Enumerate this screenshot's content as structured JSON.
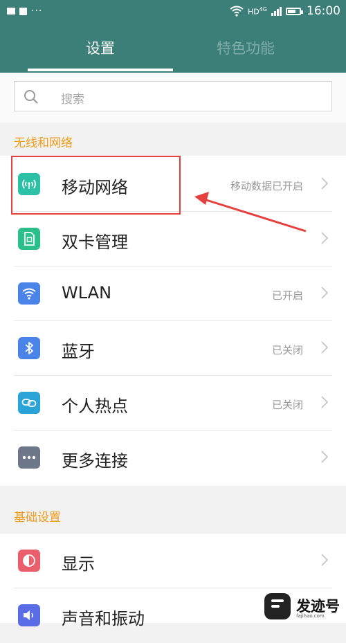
{
  "status_bar": {
    "network": "HD",
    "network_gen": "4G",
    "time": "16:00",
    "battery_level": 0.7
  },
  "tabs": [
    {
      "label": "设置",
      "active": true
    },
    {
      "label": "特色功能",
      "active": false
    }
  ],
  "search": {
    "placeholder": "搜索"
  },
  "sections": [
    {
      "title": "无线和网络",
      "items": [
        {
          "label": "移动网络",
          "status": "移动数据已开启",
          "icon": "cellular-signal-icon",
          "color": "#2cc0a7"
        },
        {
          "label": "双卡管理",
          "status": "",
          "icon": "sim-card-icon",
          "color": "#2bbf89"
        },
        {
          "label": "WLAN",
          "status": "已开启",
          "icon": "wifi-icon",
          "color": "#4a84e8"
        },
        {
          "label": "蓝牙",
          "status": "已关闭",
          "icon": "bluetooth-icon",
          "color": "#4a84e8"
        },
        {
          "label": "个人热点",
          "status": "已关闭",
          "icon": "hotspot-link-icon",
          "color": "#2aa3d6"
        },
        {
          "label": "更多连接",
          "status": "",
          "icon": "more-dots-icon",
          "color": "#6e7689"
        }
      ]
    },
    {
      "title": "基础设置",
      "items": [
        {
          "label": "显示",
          "status": "",
          "icon": "display-icon",
          "color": "#ea5f6b"
        },
        {
          "label": "声音和振动",
          "status": "",
          "icon": "sound-icon",
          "color": "#5b6de6"
        }
      ]
    }
  ],
  "watermark": {
    "text": "发迹号",
    "sub": "fajihao.com"
  },
  "colors": {
    "header": "#3c7f78",
    "section_title": "#ef9b1c",
    "highlight": "#e5403d"
  }
}
